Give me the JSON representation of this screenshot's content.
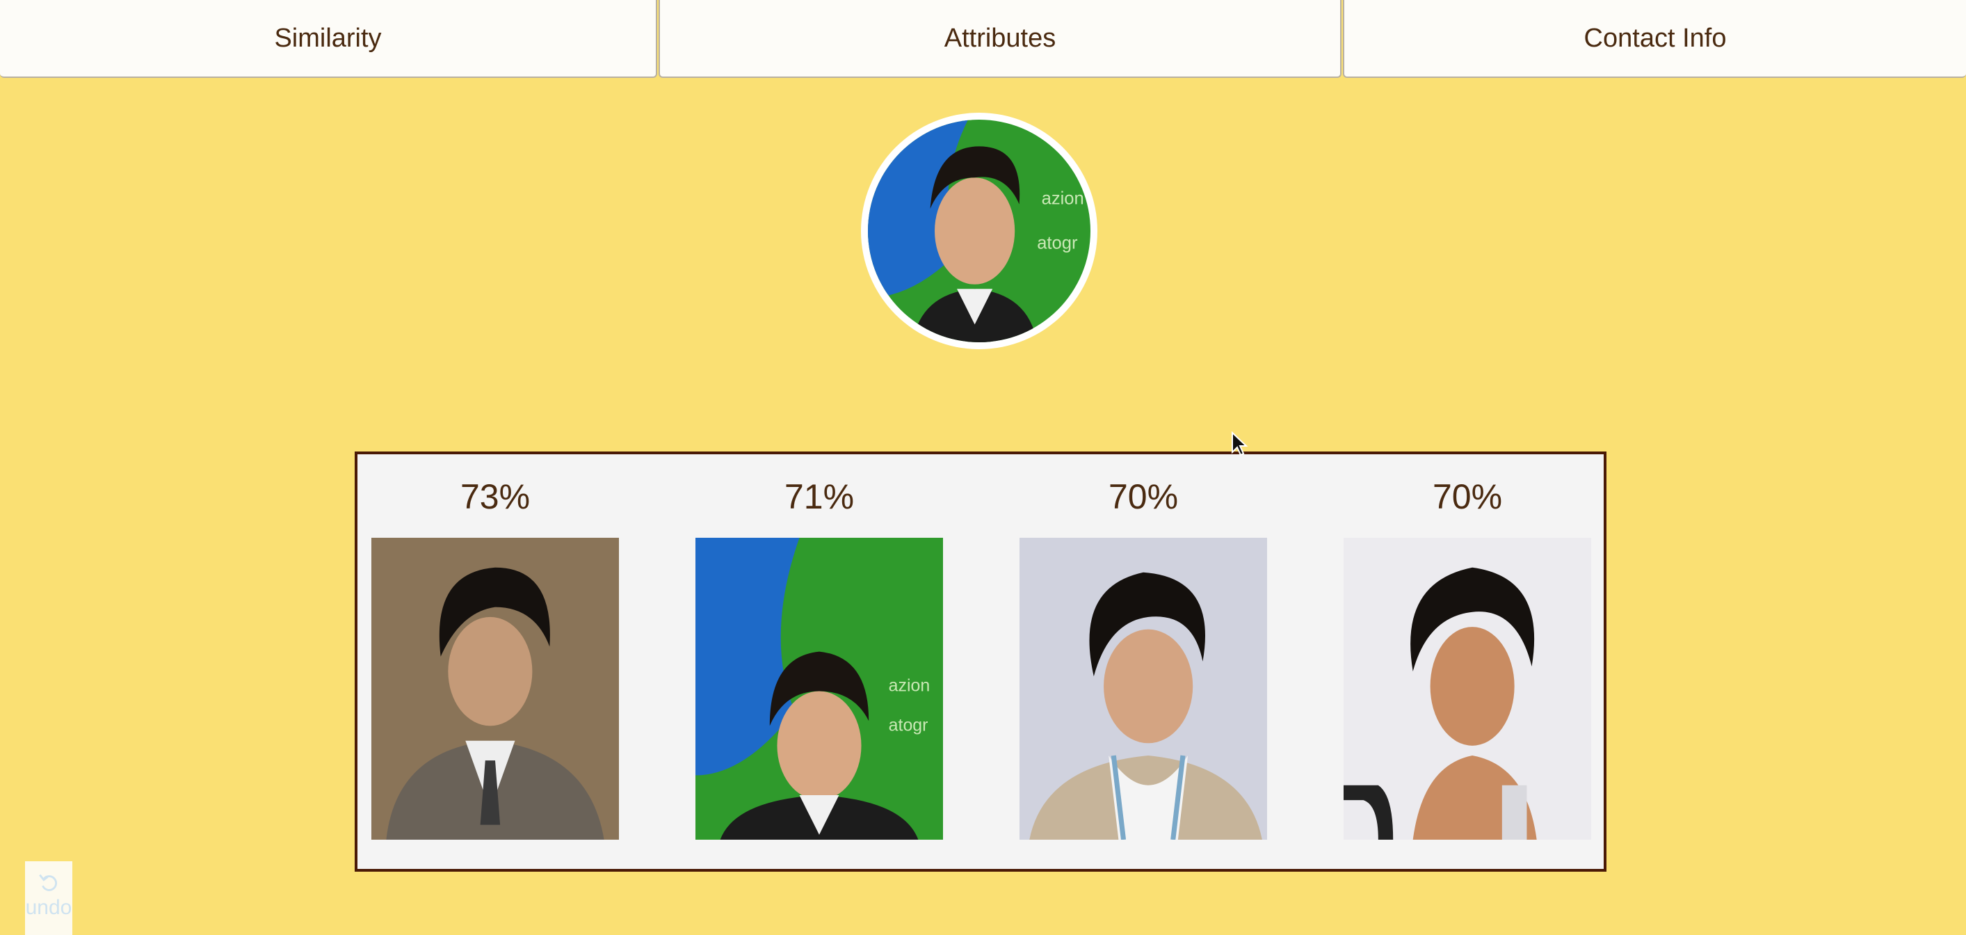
{
  "tabs": [
    {
      "label": "Similarity"
    },
    {
      "label": "Attributes"
    },
    {
      "label": "Contact Info"
    }
  ],
  "results": [
    {
      "score": "73%",
      "photo": "face-photo-1"
    },
    {
      "score": "71%",
      "photo": "face-photo-2"
    },
    {
      "score": "70%",
      "photo": "face-photo-3"
    },
    {
      "score": "70%",
      "photo": "face-photo-4"
    }
  ],
  "undo": {
    "label": "undo",
    "icon": "undo-icon"
  },
  "colors": {
    "background": "#fae073",
    "tab_background": "#fdfcf8",
    "text": "#4a2a10",
    "panel_border": "#4a1a06",
    "panel_background": "#f4f4f4"
  }
}
